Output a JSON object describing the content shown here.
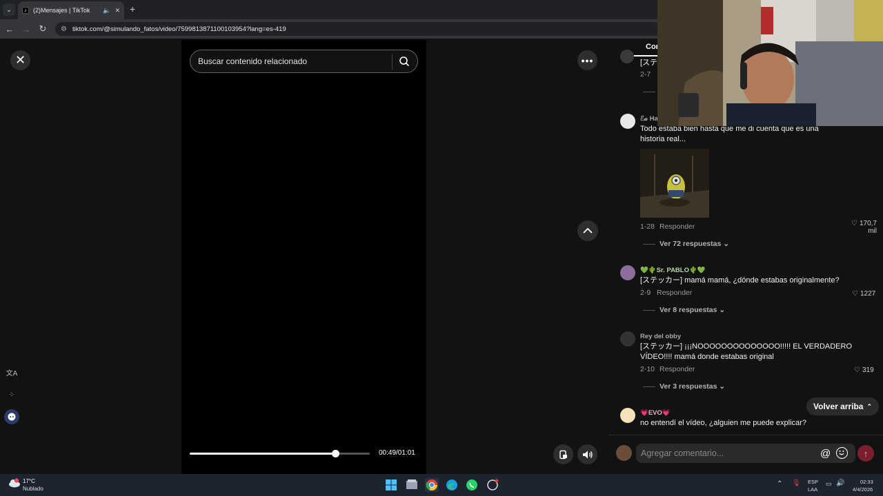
{
  "browser": {
    "tab_title": "(2)Mensajes | TikTok",
    "url": "tiktok.com/@simulando_fatos/video/7599813871100103954?lang=es-419"
  },
  "player": {
    "search_placeholder": "Buscar contenido relacionado",
    "timecode": "00:49/01:01",
    "progress_fraction": 0.81
  },
  "comments_panel": {
    "tab_label": "Cor",
    "partial_top": {
      "text": "[ステ",
      "date": "2-7"
    },
    "items": [
      {
        "username": "ℰ𝒶 Ha",
        "text_line1": "Todo estaba bien hasta que me di cuenta que es una",
        "text_line2": "historia real...",
        "date": "1-28",
        "reply_label": "Responder",
        "likes_line1": "170,7",
        "likes_line2": "mil",
        "view_replies": "Ver 72 respuestas"
      },
      {
        "username": "💚🌵Sr. PABLO🌵💚",
        "text_line1": "[ステッカー] mamá mamá, ¿dónde estabas originalmente?",
        "date": "2-9",
        "reply_label": "Responder",
        "likes": "1227",
        "view_replies": "Ver 8 respuestas"
      },
      {
        "username": "Rey del obby",
        "text_line1": "[ステッカー] ¡¡¡NOOOOOOOOOOOOOO!!!!! EL VERDADERO",
        "text_line2": "VÍDEO!!!! mamá donde estabas original",
        "date": "2-10",
        "reply_label": "Responder",
        "likes": "319",
        "view_replies": "Ver 3 respuestas"
      },
      {
        "username": "💗EVO💗",
        "text_line1": "no entendí el vídeo, ¿alguien me puede explicar?"
      }
    ],
    "back_to_top": "Volver arriba",
    "add_comment_placeholder": "Agregar comentario..."
  },
  "taskbar": {
    "temperature": "17°C",
    "weather": "Nublado",
    "lang_line1": "ESP",
    "lang_line2": "LAA",
    "time": "02:33",
    "date": "4/4/2026"
  },
  "colors": {
    "page_bg": "#121212",
    "video_bg": "#000000",
    "send_button": "#7a1f2e",
    "taskbar_bg": "#1e2330"
  }
}
